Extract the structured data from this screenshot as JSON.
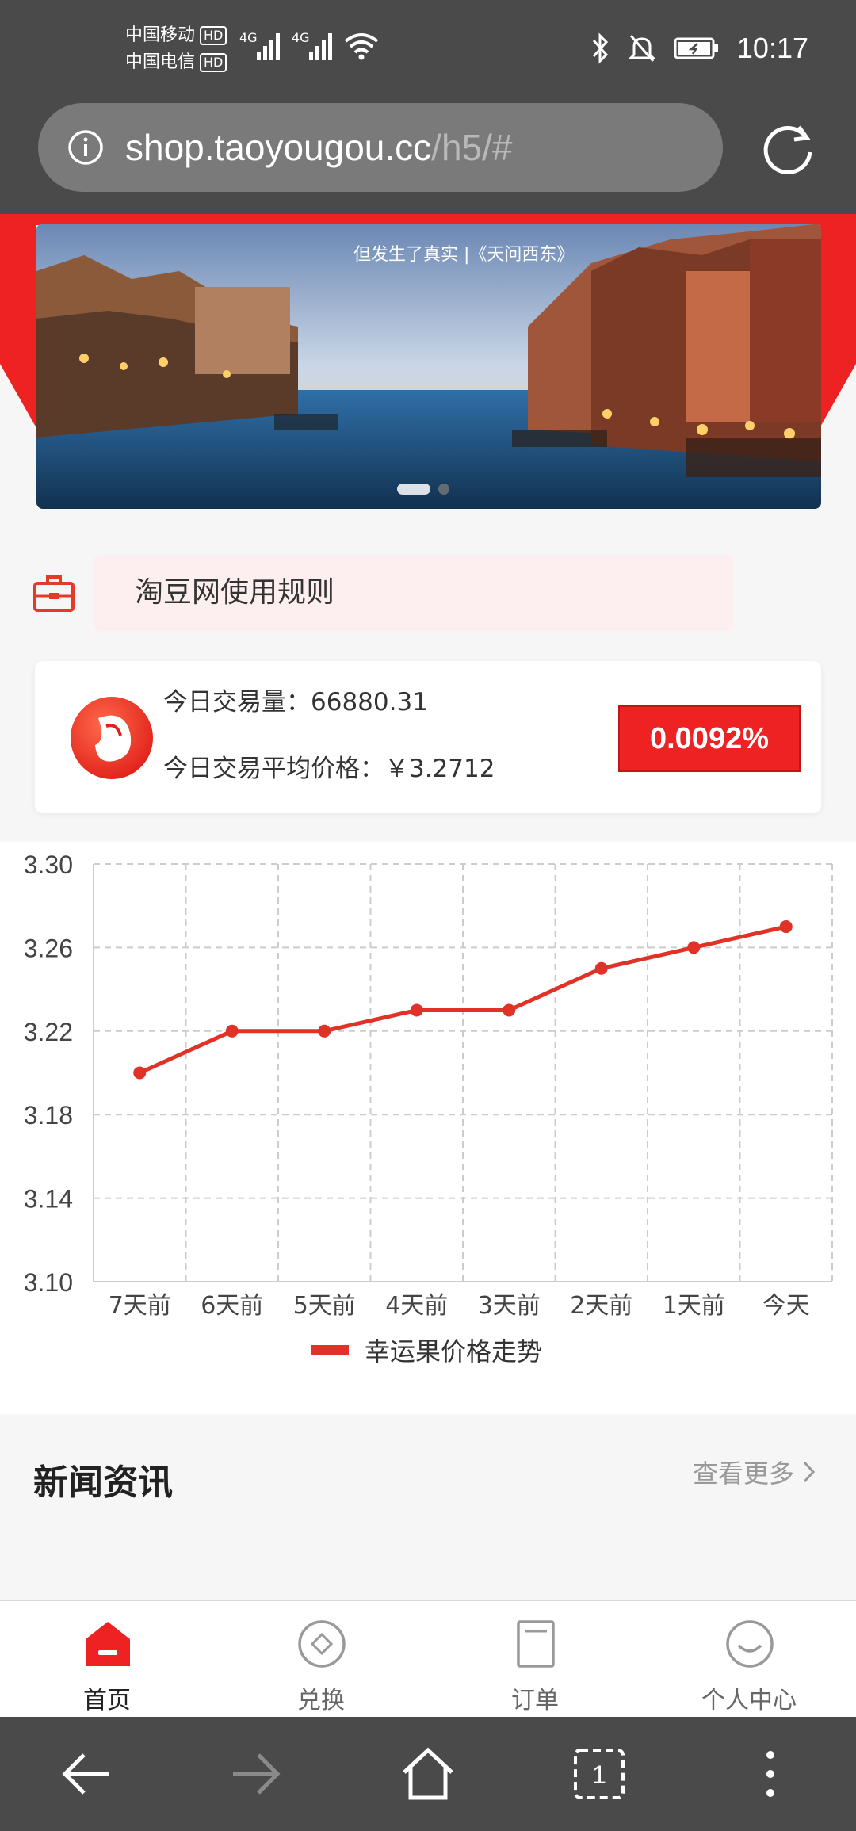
{
  "status_bar": {
    "carrier_1": "中国移动",
    "carrier_2": "中国电信",
    "hd_badge": "HD",
    "network_type": "4G",
    "time": "10:17"
  },
  "browser": {
    "url_host": "shop.taoyougou.cc",
    "url_path": "/h5/#"
  },
  "banner": {
    "overlay_text": "但发生了真实 |《天问西东》"
  },
  "rules": {
    "label": "淘豆网使用规则"
  },
  "stats": {
    "volume_label": "今日交易量：",
    "volume_value": "66880.31",
    "avg_price_label": "今日交易平均价格：",
    "avg_price_value": "￥3.2712",
    "change_pct": "0.0092%"
  },
  "chart_data": {
    "type": "line",
    "categories": [
      "7天前",
      "6天前",
      "5天前",
      "4天前",
      "3天前",
      "2天前",
      "1天前",
      "今天"
    ],
    "series": [
      {
        "name": "幸运果价格走势",
        "values": [
          3.2,
          3.22,
          3.22,
          3.23,
          3.23,
          3.25,
          3.26,
          3.27
        ]
      }
    ],
    "y_ticks": [
      "3.30",
      "3.26",
      "3.22",
      "3.18",
      "3.14",
      "3.10"
    ],
    "ylim": [
      3.1,
      3.3
    ],
    "grid": true,
    "legend_position": "bottom-center",
    "line_color": "#e03226"
  },
  "news": {
    "title": "新闻资讯",
    "more_label": "查看更多"
  },
  "tabbar": {
    "items": [
      {
        "label": "首页",
        "icon": "home-icon",
        "active": true
      },
      {
        "label": "兑换",
        "icon": "exchange-icon",
        "active": false
      },
      {
        "label": "订单",
        "icon": "order-icon",
        "active": false
      },
      {
        "label": "个人中心",
        "icon": "profile-icon",
        "active": false
      }
    ]
  },
  "system_nav": {
    "tab_count": "1"
  },
  "colors": {
    "brand_red": "#ee2222",
    "chrome_gray": "#4a4a4a"
  }
}
